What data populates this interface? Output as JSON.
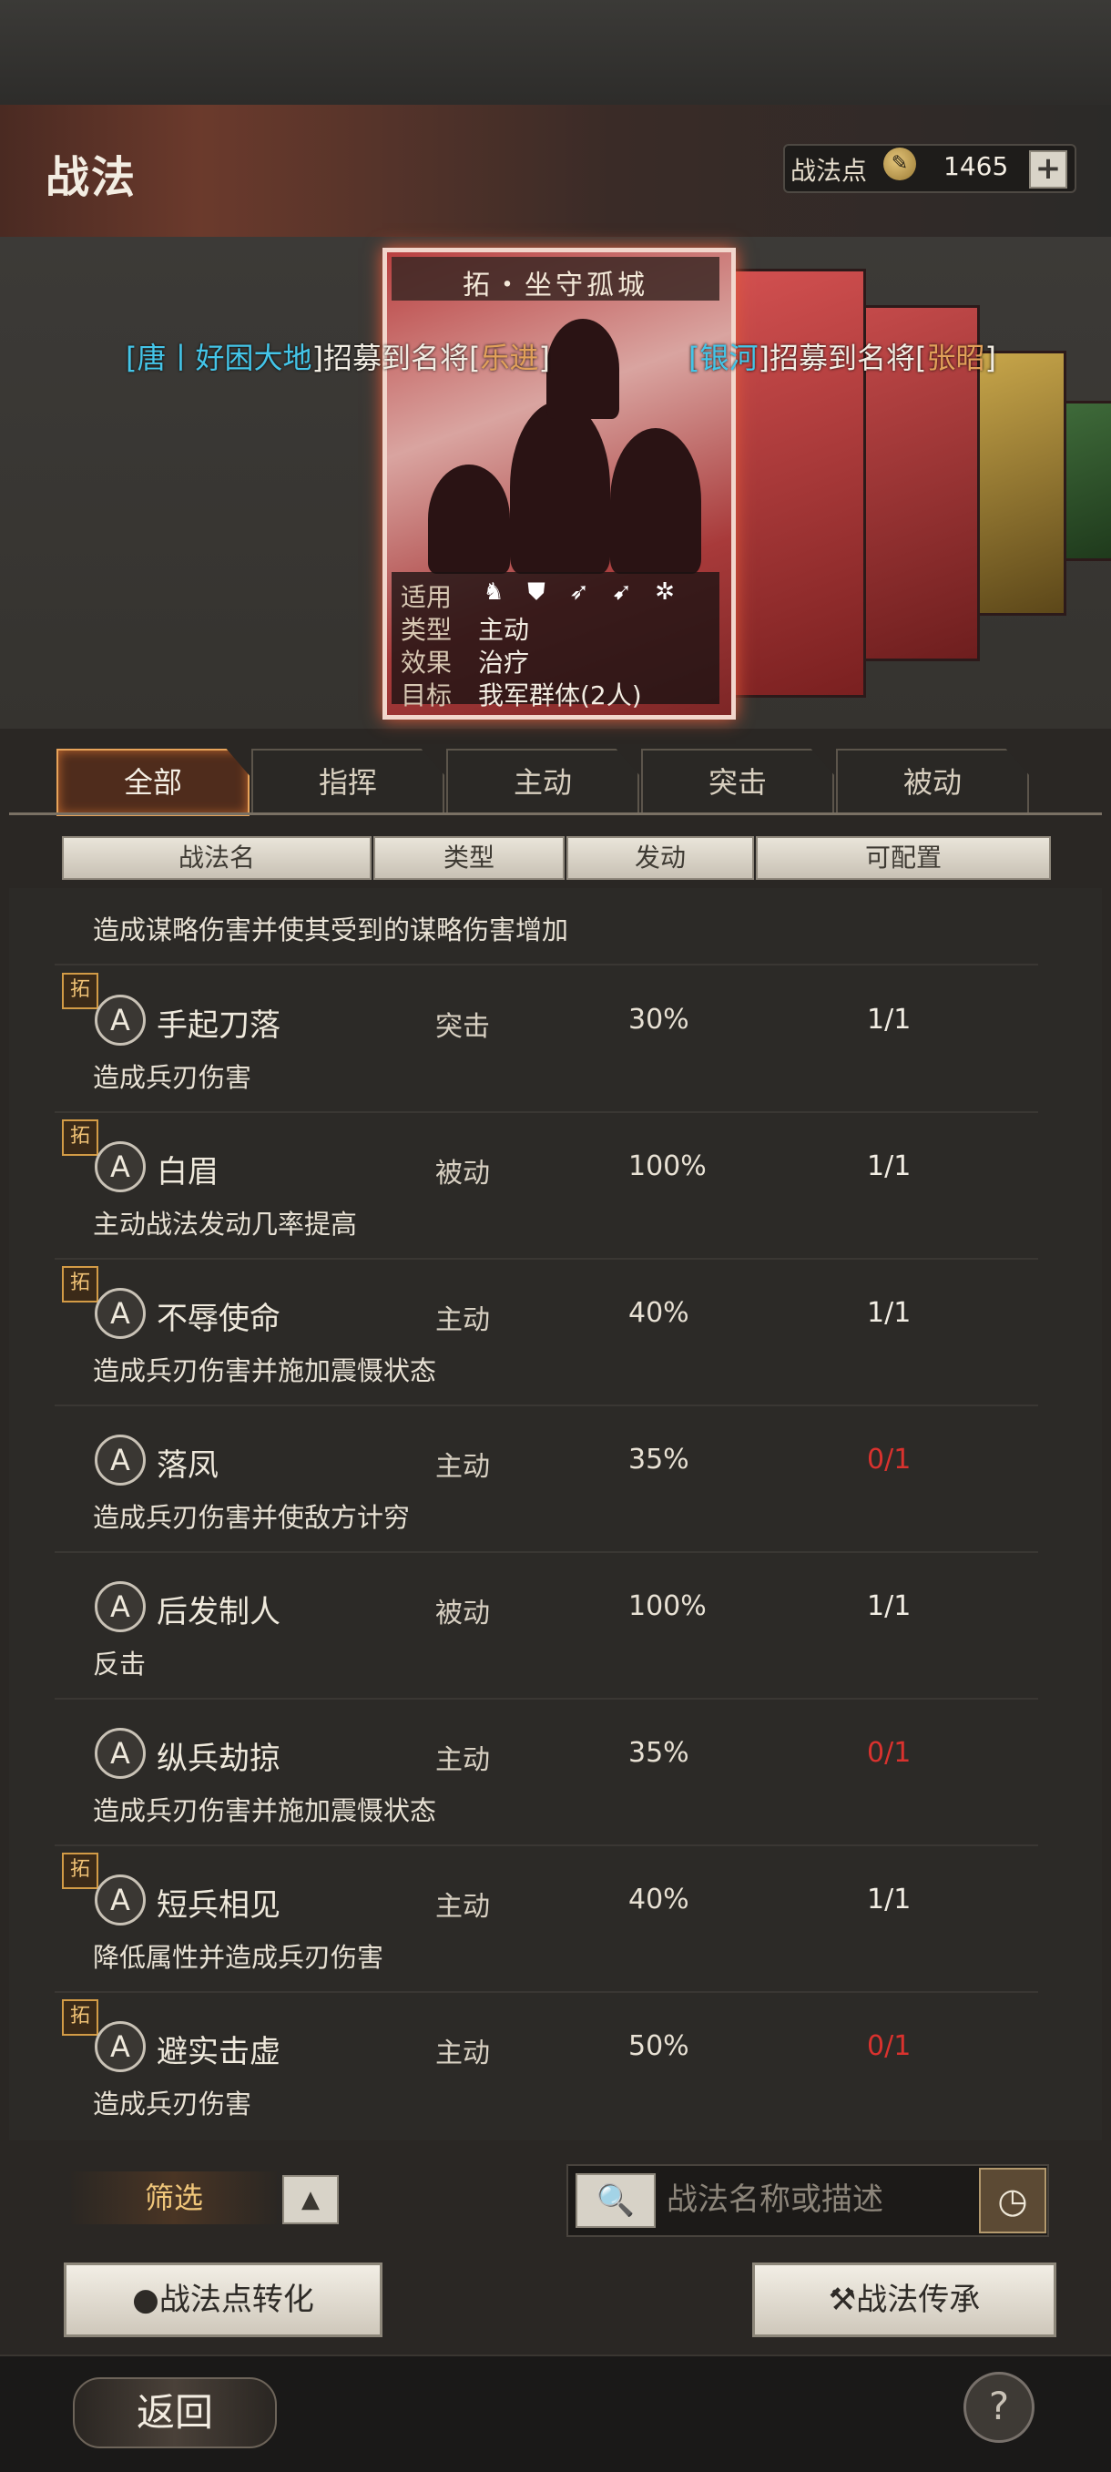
{
  "header": {
    "title": "战法",
    "points_label": "战法点",
    "points_icon": "feather-coin-icon",
    "points_value": "1465",
    "plus_label": "+"
  },
  "card": {
    "title": "拓・坐守孤城",
    "info": [
      {
        "label": "适用",
        "value": ""
      },
      {
        "label": "类型",
        "value": "主动"
      },
      {
        "label": "效果",
        "value": "治疗"
      },
      {
        "label": "目标",
        "value": "我军群体(2人)"
      }
    ],
    "applies_icons": [
      "cavalry-icon",
      "shield-icon",
      "bow-icon",
      "spear-icon",
      "wheel-icon"
    ]
  },
  "recruit_messages": [
    {
      "prefix": "[",
      "server": "唐丨好困大地",
      "mid": "]招募到名将[",
      "general": "乐进",
      "suffix": "]"
    },
    {
      "prefix": "[",
      "server": "银河",
      "mid": "]招募到名将[",
      "general": "张昭",
      "suffix": "]"
    }
  ],
  "tabs": [
    "全部",
    "指挥",
    "主动",
    "突击",
    "被动"
  ],
  "columns": [
    "战法名",
    "类型",
    "发动",
    "可配置"
  ],
  "partial_row_desc": "造成谋略伤害并使其受到的谋略伤害增加",
  "tuo_badge": "拓",
  "a_label": "A",
  "rows": [
    {
      "tuo": true,
      "name": "手起刀落",
      "type": "突击",
      "rate": "30%",
      "config": "1/1",
      "config_red": false,
      "desc": "造成兵刃伤害"
    },
    {
      "tuo": true,
      "name": "白眉",
      "type": "被动",
      "rate": "100%",
      "config": "1/1",
      "config_red": false,
      "desc": "主动战法发动几率提高"
    },
    {
      "tuo": true,
      "name": "不辱使命",
      "type": "主动",
      "rate": "40%",
      "config": "1/1",
      "config_red": false,
      "desc": "造成兵刃伤害并施加震慑状态"
    },
    {
      "tuo": false,
      "name": "落凤",
      "type": "主动",
      "rate": "35%",
      "config": "0/1",
      "config_red": true,
      "desc": "造成兵刃伤害并使敌方计穷"
    },
    {
      "tuo": false,
      "name": "后发制人",
      "type": "被动",
      "rate": "100%",
      "config": "1/1",
      "config_red": false,
      "desc": "反击"
    },
    {
      "tuo": false,
      "name": "纵兵劫掠",
      "type": "主动",
      "rate": "35%",
      "config": "0/1",
      "config_red": true,
      "desc": "造成兵刃伤害并施加震慑状态"
    },
    {
      "tuo": true,
      "name": "短兵相见",
      "type": "主动",
      "rate": "40%",
      "config": "1/1",
      "config_red": false,
      "desc": "降低属性并造成兵刃伤害"
    },
    {
      "tuo": true,
      "name": "避实击虚",
      "type": "主动",
      "rate": "50%",
      "config": "0/1",
      "config_red": true,
      "desc": "造成兵刃伤害"
    }
  ],
  "controls": {
    "filter_label": "筛选",
    "filter_arrow_icon": "triangle-up-icon",
    "search_icon": "magnifier-icon",
    "search_placeholder": "战法名称或描述",
    "history_icon": "clock-icon",
    "convert_label": "战法点转化",
    "convert_icon": "flame-icon",
    "inherit_label": "战法传承",
    "inherit_icon": "hammer-icon",
    "back_label": "返回",
    "help_label": "?"
  }
}
